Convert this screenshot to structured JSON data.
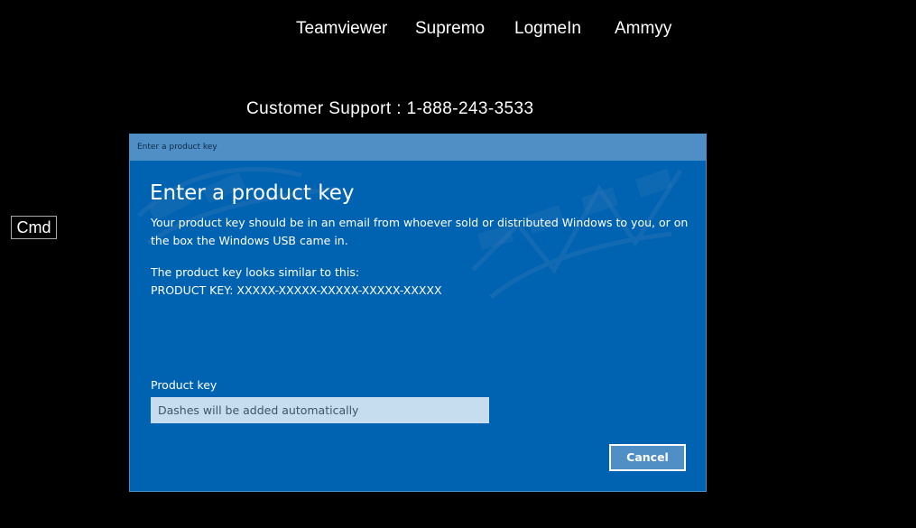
{
  "top_links": {
    "teamviewer": "Teamviewer",
    "supremo": "Supremo",
    "logmein": "LogmeIn",
    "ammyy": "Ammyy"
  },
  "support_line": "Customer Support : 1-888-243-3533",
  "cmd_label": "Cmd",
  "dialog": {
    "window_title": "Enter a product key",
    "heading": "Enter a product key",
    "description": "Your product key should be in an email from whoever sold or distributed Windows to you, or on the box the Windows USB came in.",
    "similar_label": "The product key looks similar to this:",
    "similar_example": "PRODUCT KEY: XXXXX-XXXXX-XXXXX-XXXXX-XXXXX",
    "product_key_label": "Product key",
    "product_key_placeholder": "Dashes will be added automatically",
    "product_key_value": "",
    "cancel_label": "Cancel"
  },
  "colors": {
    "page_background": "#000000",
    "dialog_background": "#0063b1",
    "dialog_titlebar": "#4f8fc6",
    "input_background": "#c6dcef",
    "cancel_button_background": "#4f8fc6",
    "text": "#ffffff"
  }
}
